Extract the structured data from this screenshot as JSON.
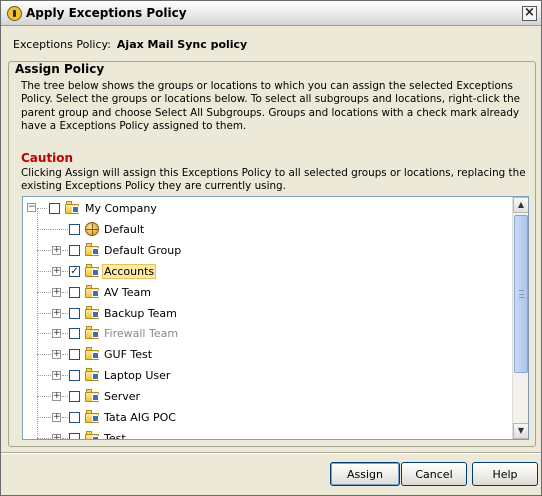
{
  "window": {
    "title": "Apply Exceptions Policy",
    "close_glyph": "×"
  },
  "policy": {
    "label": "Exceptions Policy:",
    "value": "Ajax Mail Sync policy"
  },
  "assign_policy": {
    "title": "Assign Policy",
    "description": "The tree below shows the groups or locations to which you can assign the selected Exceptions Policy. Select the groups or locations below. To select all subgroups and locations, right-click the parent group and choose Select All Subgroups. Groups and locations with a check mark already have a Exceptions Policy assigned to them."
  },
  "caution": {
    "title": "Caution",
    "text": "Clicking Assign will assign this Exceptions Policy to all selected groups or locations, replacing the existing Exceptions Policy they are currently using."
  },
  "tree": {
    "root": {
      "label": "My Company",
      "checked": false,
      "expander": "−"
    },
    "children": [
      {
        "label": "Default",
        "checked": false,
        "icon": "location-globe-icon",
        "expander": ""
      },
      {
        "label": "Default Group",
        "checked": false,
        "icon": "group-folder-icon",
        "expander": "+"
      },
      {
        "label": "Accounts",
        "checked": true,
        "icon": "group-folder-icon",
        "expander": "+",
        "selected": true
      },
      {
        "label": "AV Team",
        "checked": false,
        "icon": "group-folder-icon",
        "expander": "+"
      },
      {
        "label": "Backup Team",
        "checked": false,
        "icon": "group-folder-icon",
        "expander": "+"
      },
      {
        "label": "Firewall Team",
        "checked": false,
        "icon": "group-folder-icon",
        "expander": "+",
        "disabled": true
      },
      {
        "label": "GUF Test",
        "checked": false,
        "icon": "group-folder-icon",
        "expander": "+"
      },
      {
        "label": "Laptop User",
        "checked": false,
        "icon": "group-folder-icon",
        "expander": "+"
      },
      {
        "label": "Server",
        "checked": false,
        "icon": "group-folder-icon",
        "expander": "+"
      },
      {
        "label": "Tata AIG POC",
        "checked": false,
        "icon": "group-folder-icon",
        "expander": "+"
      },
      {
        "label": "Test",
        "checked": false,
        "icon": "group-folder-icon",
        "expander": "+"
      }
    ]
  },
  "scrollbar": {
    "up_glyph": "▲",
    "down_glyph": "▼"
  },
  "buttons": {
    "assign": "Assign",
    "cancel": "Cancel",
    "help": "Help"
  }
}
